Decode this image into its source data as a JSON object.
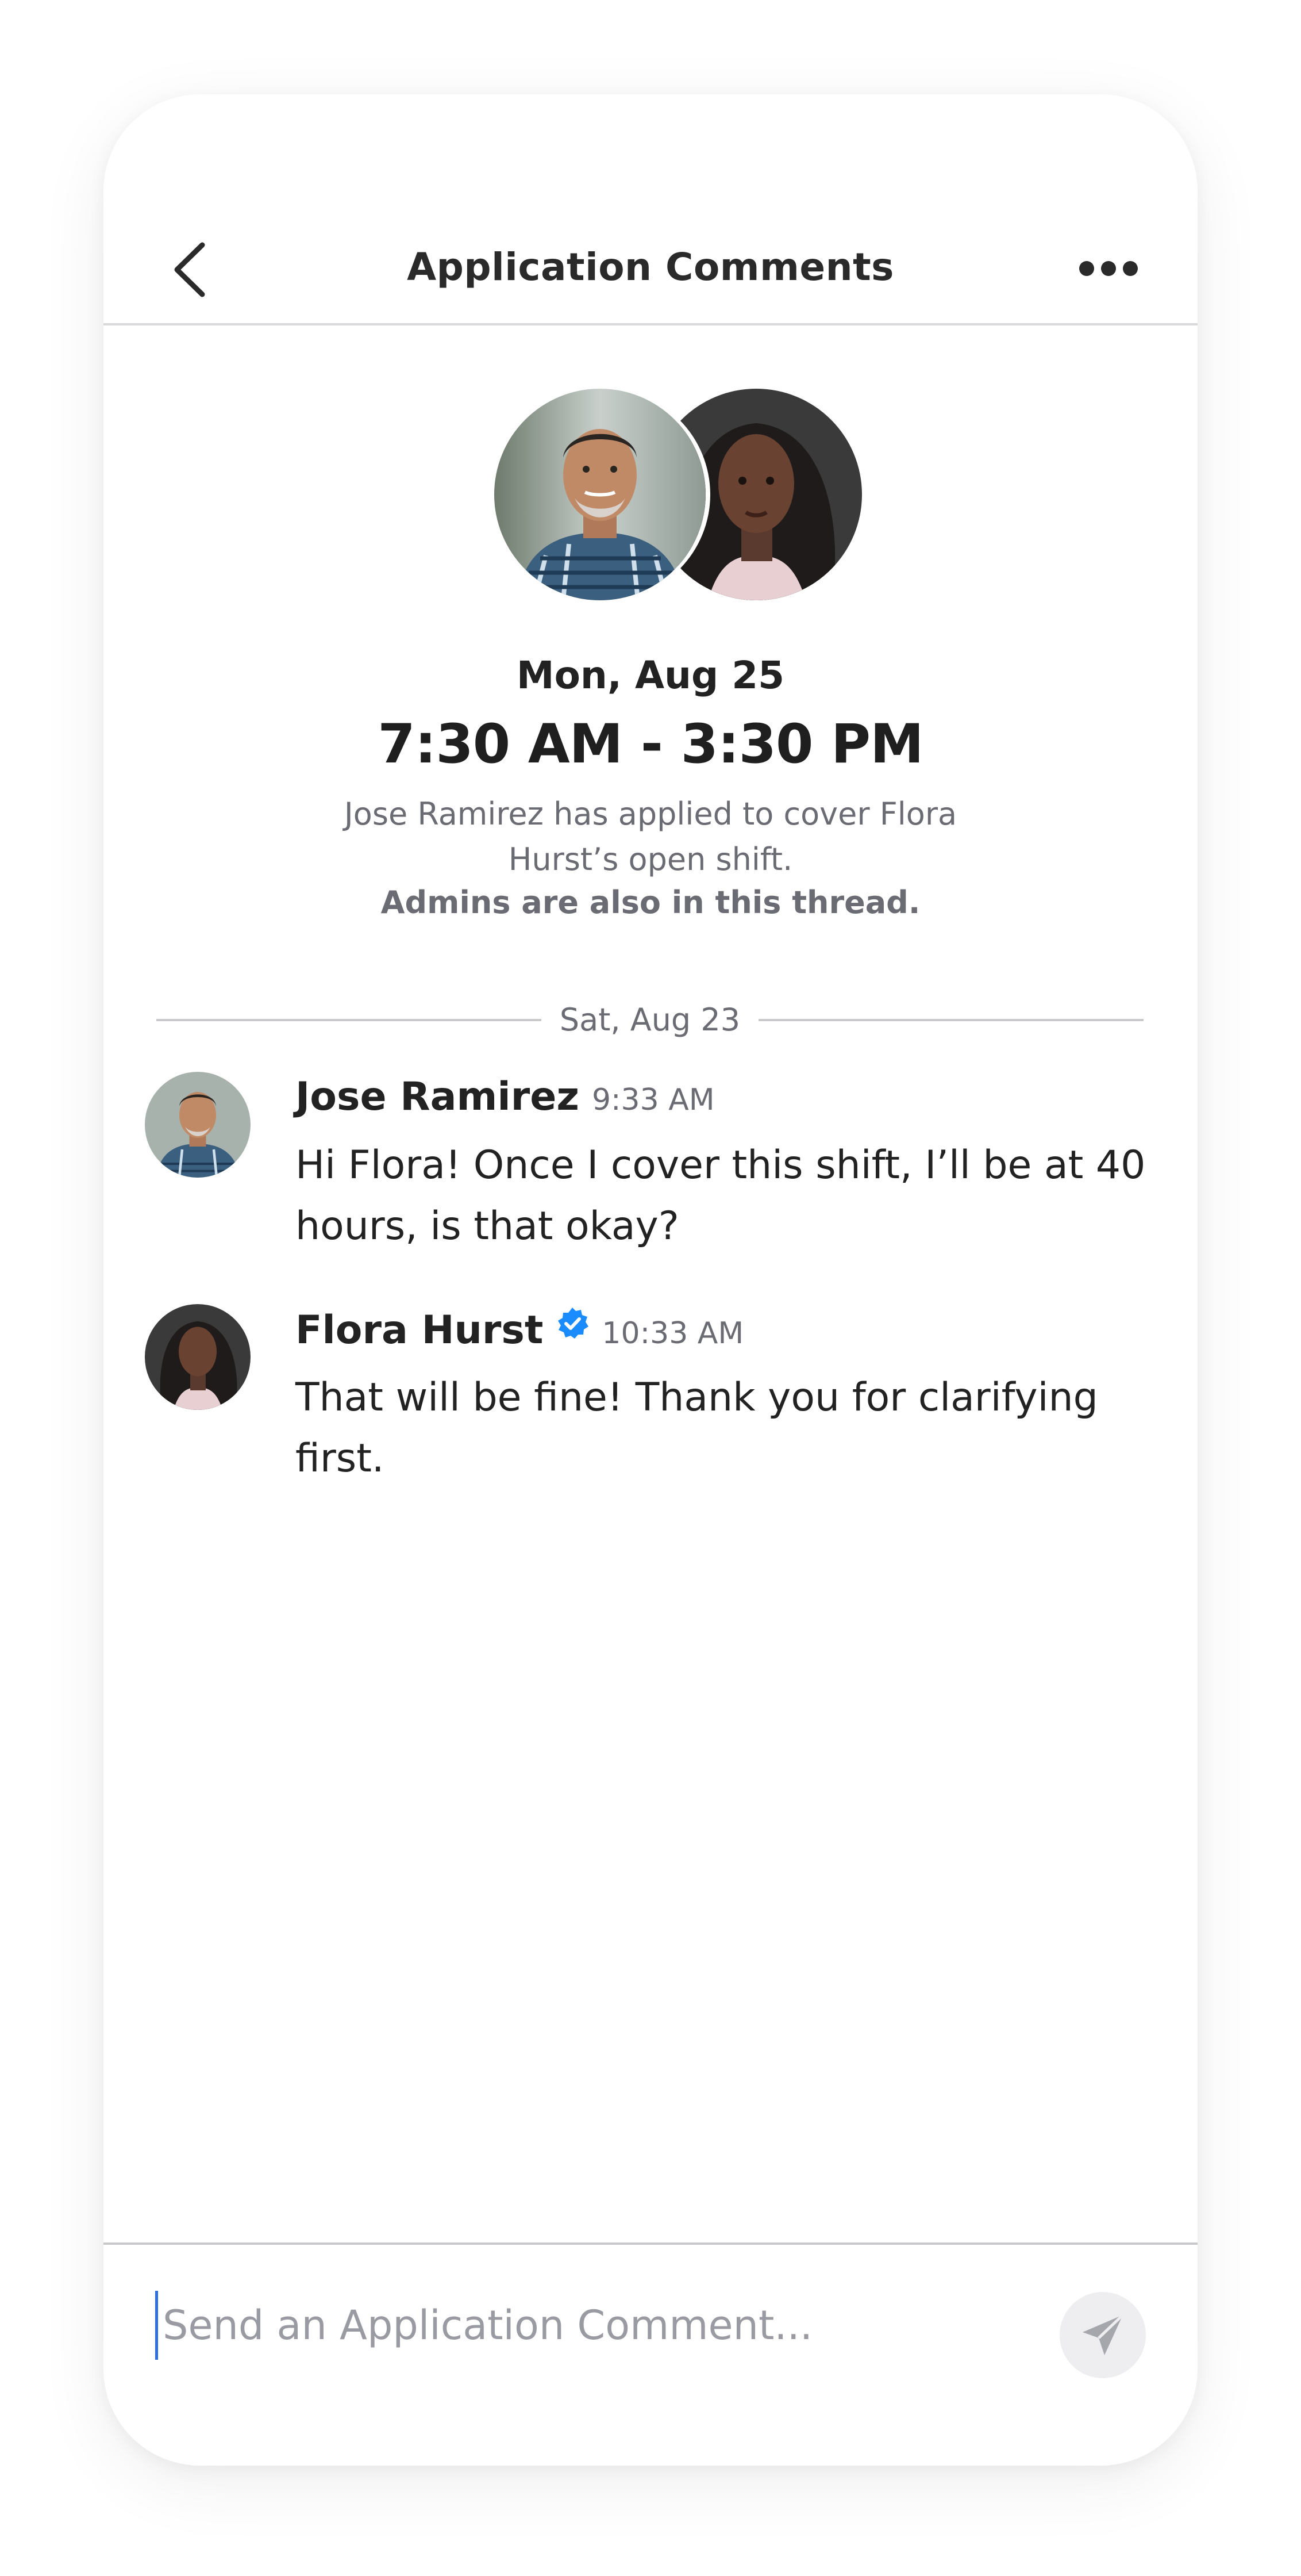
{
  "header": {
    "title": "Application Comments",
    "back_icon": "chevron-left-icon",
    "more_icon": "more-horizontal-icon"
  },
  "shift": {
    "date": "Mon, Aug 25",
    "time": "7:30 AM - 3:30 PM",
    "description": "Jose Ramirez has applied to cover Flora Hurst’s open shift.",
    "note": "Admins are also in this thread."
  },
  "thread": {
    "day_label": "Sat, Aug 23",
    "messages": [
      {
        "author": "Jose Ramirez",
        "time": "9:33 AM",
        "verified": false,
        "text": "Hi Flora! Once I cover this shift, I’ll be at 40 hours, is that okay?"
      },
      {
        "author": "Flora Hurst",
        "time": "10:33 AM",
        "verified": true,
        "text": "That will be fine! Thank you for clarifying first."
      }
    ]
  },
  "composer": {
    "placeholder": "Send an Application Comment...",
    "value": "",
    "send_icon": "send-icon"
  },
  "colors": {
    "accent": "#2a6fdb",
    "verified_badge": "#1a8cff",
    "muted_text": "#6b6b73",
    "divider": "#c9c9cc",
    "send_button_bg": "#eeeef1"
  }
}
